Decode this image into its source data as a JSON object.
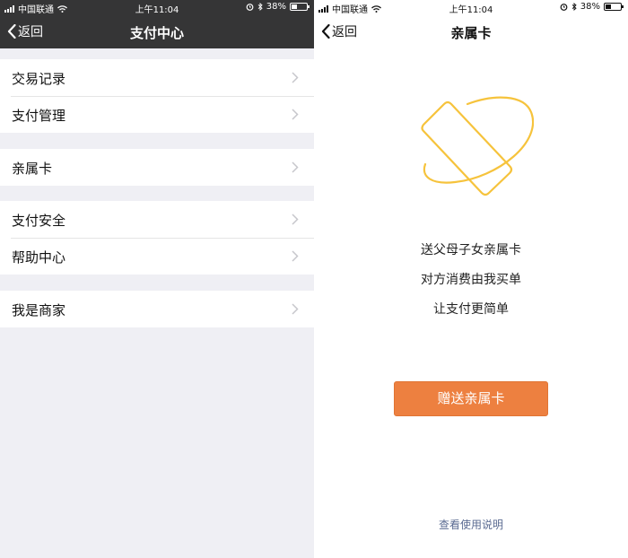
{
  "status_bar": {
    "carrier": "中国联通",
    "time": "上午11:04",
    "battery": "38%",
    "battery_level": 0.38
  },
  "left": {
    "nav": {
      "back_label": "返回",
      "title": "支付中心"
    },
    "groups": [
      {
        "items": [
          {
            "label": "交易记录"
          },
          {
            "label": "支付管理"
          }
        ]
      },
      {
        "items": [
          {
            "label": "亲属卡"
          }
        ]
      },
      {
        "items": [
          {
            "label": "支付安全"
          },
          {
            "label": "帮助中心"
          }
        ]
      },
      {
        "items": [
          {
            "label": "我是商家"
          }
        ]
      }
    ]
  },
  "right": {
    "nav": {
      "back_label": "返回",
      "title": "亲属卡"
    },
    "card_icon": "family-card-icon",
    "promo_lines": [
      "送父母子女亲属卡",
      "对方消费由我买单",
      "让支付更简单"
    ],
    "gift_button": "赠送亲属卡",
    "help_link": "查看使用说明",
    "colors": {
      "accent": "#ed8040",
      "card_stroke": "#f6c33c",
      "link": "#5b6b92"
    }
  }
}
